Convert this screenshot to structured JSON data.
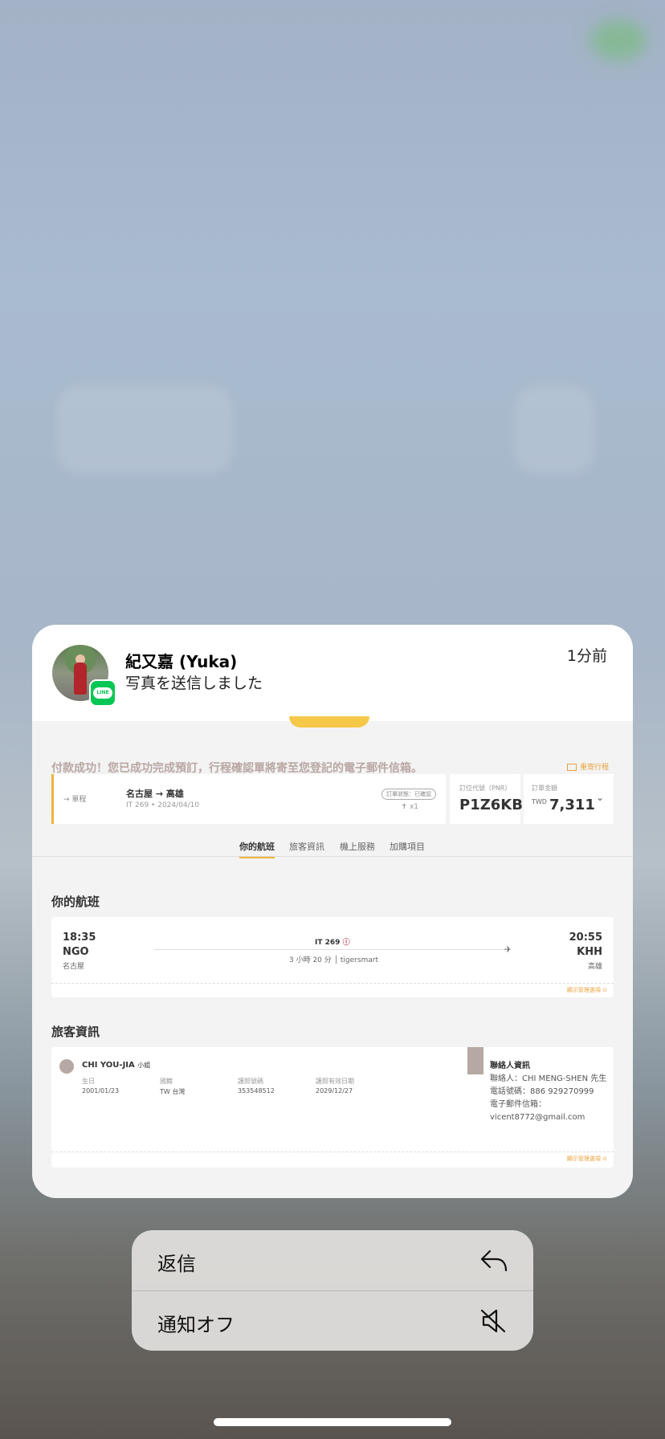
{
  "notification": {
    "sender": "紀又嘉 (Yuka)",
    "message": "写真を送信しました",
    "time": "1分前",
    "app_badge": "LINE"
  },
  "screenshot": {
    "banner": "付款成功！您已成功完成預訂，行程確認單將寄至您登記的電子郵件信箱。",
    "email_itinerary": "重寄行程",
    "summary": {
      "trip_type": "單程",
      "route": "名古屋 → 高雄",
      "sub": "IT 269 • 2024/04/10",
      "status": "訂單狀態：已確認",
      "pax_count": "x1",
      "pnr_label": "訂位代號（PNR）",
      "pnr": "P1Z6KB",
      "amount_label": "訂單金額",
      "currency": "TWD",
      "amount": "7,311"
    },
    "tabs": [
      "你的航班",
      "旅客資訊",
      "機上服務",
      "加購項目"
    ],
    "flight_section": {
      "title": "你的航班",
      "dep_time": "18:35",
      "dep_code": "NGO",
      "dep_city": "名古屋",
      "flight_no": "IT 269",
      "duration": "3 小時 20 分",
      "fare": "tigersmart",
      "arr_time": "20:55",
      "arr_code": "KHH",
      "arr_city": "高雄",
      "manage": "顯示管理選項"
    },
    "passenger_section": {
      "title": "旅客資訊",
      "name": "CHI YOU-JIA",
      "title_suffix": "小姐",
      "fields": [
        {
          "label": "生日",
          "value": "2001/01/23"
        },
        {
          "label": "國籍",
          "value": "TW 台灣"
        },
        {
          "label": "護照號碼",
          "value": "353548512"
        },
        {
          "label": "護照有效日期",
          "value": "2029/12/27"
        }
      ],
      "contact_title": "聯絡人資訊",
      "contact_person": "聯絡人：CHI MENG-SHEN 先生",
      "contact_phone": "電話號碼：886 929270999",
      "contact_email_label": "電子郵件信箱：",
      "contact_email": "vicent8772@gmail.com",
      "manage": "顯示管理選項"
    }
  },
  "menu": {
    "reply": "返信",
    "mute": "通知オフ"
  },
  "colors": {
    "accent": "#f1b43b",
    "line_green": "#06c755"
  }
}
